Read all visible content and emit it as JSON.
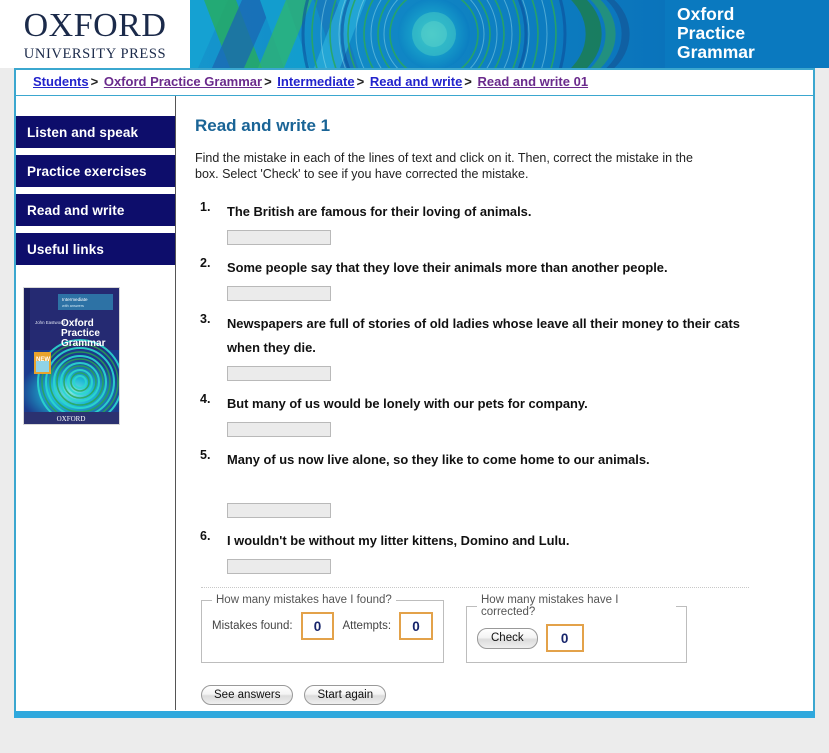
{
  "masthead": {
    "logo_title": "OXFORD",
    "logo_subtitle": "UNIVERSITY PRESS",
    "banner_line1": "Oxford",
    "banner_line2": "Practice",
    "banner_line3": "Grammar",
    "banner_bg": "#0a79bf"
  },
  "breadcrumb": {
    "items": [
      {
        "label": "Students",
        "state": "link"
      },
      {
        "label": "Oxford Practice Grammar",
        "state": "visited"
      },
      {
        "label": "Intermediate",
        "state": "link"
      },
      {
        "label": "Read and write",
        "state": "link"
      },
      {
        "label": "Read and write 01",
        "state": "visited"
      }
    ],
    "separator": ">"
  },
  "sidebar": {
    "items": [
      {
        "label": "Listen and speak"
      },
      {
        "label": "Practice exercises"
      },
      {
        "label": "Read and write"
      },
      {
        "label": "Useful links"
      }
    ],
    "book_cover": {
      "level": "Intermediate",
      "level_sub": "with answers",
      "author": "John Eastwood",
      "title_line1": "Oxford",
      "title_line2": "Practice",
      "title_line3": "Grammar",
      "badge": "NEW",
      "publisher": "OXFORD"
    }
  },
  "main": {
    "title": "Read and write 1",
    "instructions": "Find the mistake in each of the lines of text and click on it. Then, correct the mistake in the box. Select 'Check' to see if you have corrected the mistake.",
    "questions": [
      {
        "number": "1.",
        "text": "The British are famous for their loving of animals.",
        "answer_value": "",
        "extra_gap": false
      },
      {
        "number": "2.",
        "text": "Some people say that they love their animals more than another people.",
        "answer_value": "",
        "extra_gap": false
      },
      {
        "number": "3.",
        "text": "Newspapers are full of stories of old ladies whose leave all their money to their cats when they die.",
        "answer_value": "",
        "extra_gap": false
      },
      {
        "number": "4.",
        "text": "But many of us would be lonely with our pets for company.",
        "answer_value": "",
        "extra_gap": false
      },
      {
        "number": "5.",
        "text": "Many of us now live alone, so they like to come home to our animals.",
        "answer_value": "",
        "extra_gap": true
      },
      {
        "number": "6.",
        "text": "I wouldn't be without my litter kittens, Domino and Lulu.",
        "answer_value": "",
        "extra_gap": false
      }
    ],
    "score_found": {
      "legend": "How many mistakes have I found?",
      "label_mistakes": "Mistakes found:",
      "value_mistakes": "0",
      "label_attempts": "Attempts:",
      "value_attempts": "0"
    },
    "score_corrected": {
      "legend": "How many mistakes have I corrected?",
      "check_label": "Check",
      "value_corrected": "0"
    },
    "buttons": {
      "see_answers": "See answers",
      "start_again": "Start again"
    }
  },
  "colors": {
    "heading": "#1a6496",
    "nav_bg": "#0d0d6b",
    "frame_border": "#3ba7cf",
    "bottom_bar": "#2fa8dd",
    "num_box_border": "#e3a24a",
    "num_text": "#16246b"
  }
}
